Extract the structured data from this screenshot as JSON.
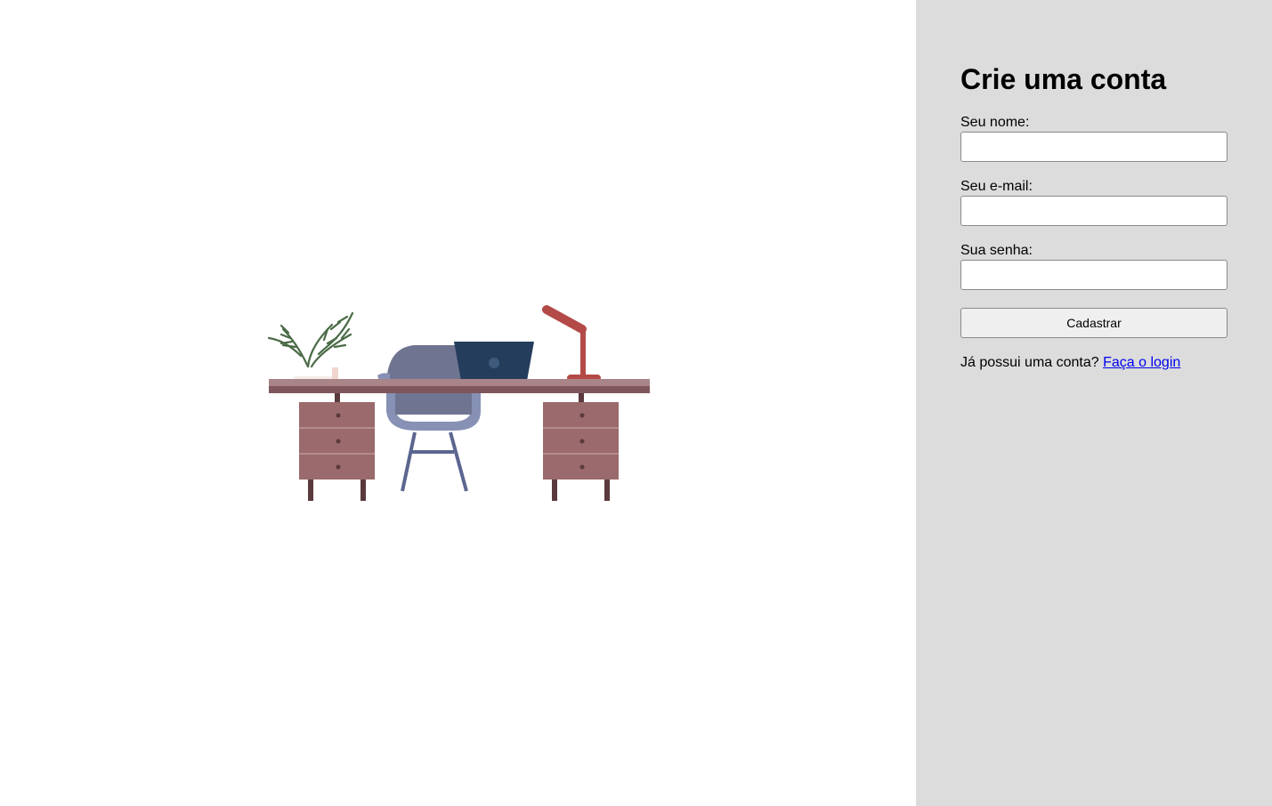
{
  "illustration": {
    "icon": "desk-workspace-illustration",
    "colors": {
      "desk_top": "#a9858a",
      "desk_edge": "#7e565c",
      "drawer": "#9a6a6c",
      "drawer_line": "#b58c8d",
      "legs": "#5a3a3c",
      "chair_back": "#6f7590",
      "chair_seat": "#8791b5",
      "laptop": "#253d5c",
      "lamp": "#b34a48",
      "plant": "#4a6b46",
      "pot": "#f0d6cf"
    }
  },
  "panel": {
    "background": "#dcdcdc",
    "title": "Crie uma conta",
    "fields": [
      {
        "label": "Seu nome:",
        "value": "",
        "placeholder": ""
      },
      {
        "label": "Seu e-mail:",
        "value": "",
        "placeholder": ""
      },
      {
        "label": "Sua senha:",
        "value": "",
        "placeholder": ""
      }
    ],
    "submit_label": "Cadastrar",
    "login_prompt": "Já possui uma conta?",
    "login_link": "Faça o login"
  }
}
